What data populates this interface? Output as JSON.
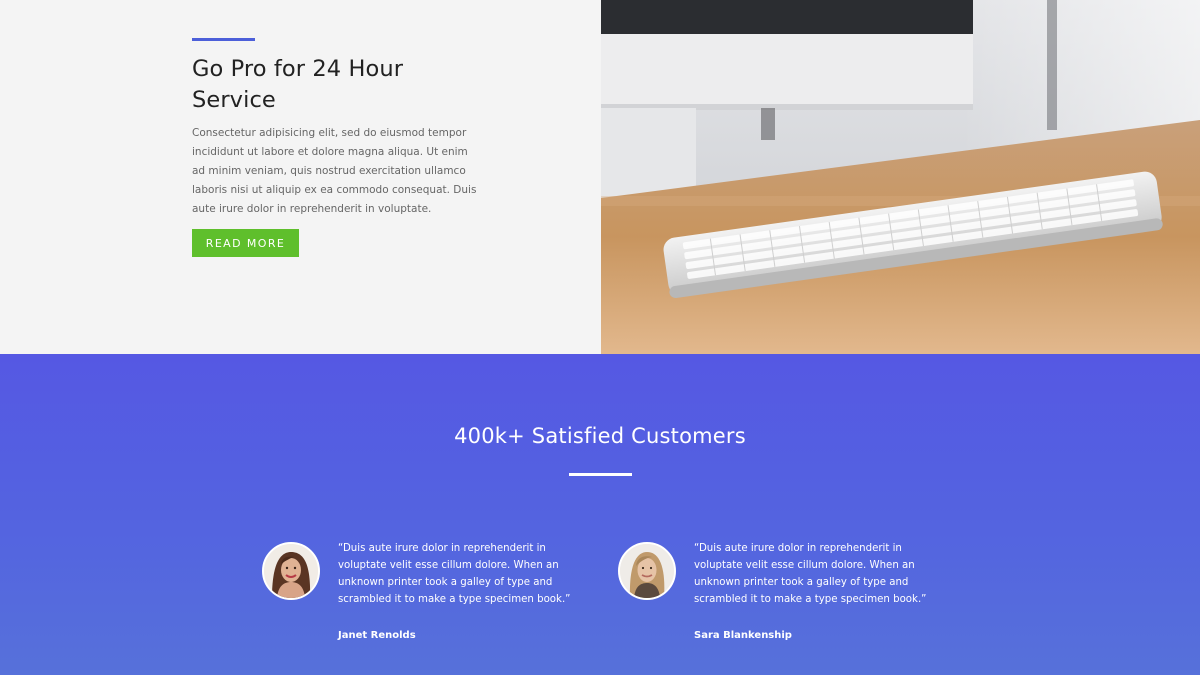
{
  "promo": {
    "title": "Go Pro for 24 Hour Service",
    "body": "Consectetur adipisicing elit, sed do eiusmod tempor incididunt ut labore et dolore magna aliqua. Ut enim ad minim veniam, quis nostrud exercitation ullamco laboris nisi ut aliquip ex ea commodo consequat. Duis aute irure dolor in reprehenderit in voluptate.",
    "button_label": "READ MORE"
  },
  "testimonials": {
    "title": "400k+ Satisfied Customers",
    "items": [
      {
        "quote": "“Duis aute irure dolor in reprehenderit in voluptate velit esse cillum dolore.  When an unknown printer took a galley of type and scrambled it to make a type specimen book.”",
        "author": "Janet Renolds"
      },
      {
        "quote": "“Duis aute irure dolor in reprehenderit in voluptate velit esse cillum dolore.  When an unknown printer took a galley of type and scrambled it to make a type specimen book.”",
        "author": "Sara Blankenship"
      }
    ]
  },
  "colors": {
    "accent": "#4c5fd9",
    "button": "#5fbf2c",
    "section_gradient_top": "#5558e3",
    "section_gradient_bottom": "#5671da"
  }
}
